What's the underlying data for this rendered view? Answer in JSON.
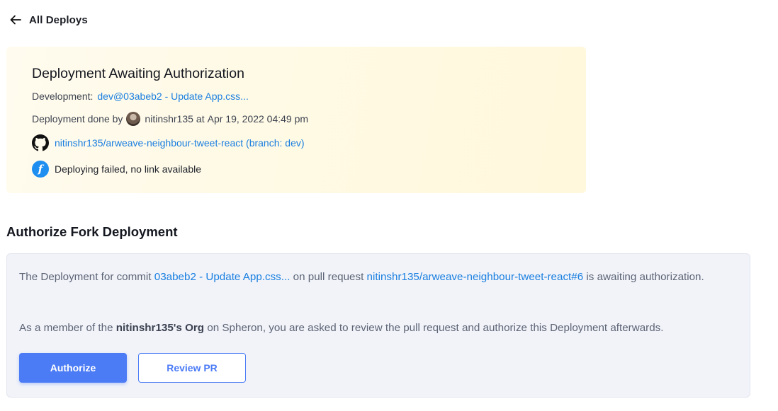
{
  "back": {
    "label": "All Deploys",
    "icon": "arrow-left-icon"
  },
  "deployment": {
    "title": "Deployment Awaiting Authorization",
    "env_label": "Development:",
    "env_link": "dev@03abeb2 - Update App.css...",
    "done_by_label": "Deployment done by",
    "done_by_user": "nitinshr135",
    "at_label": "at",
    "timestamp": "Apr 19, 2022 04:49 pm",
    "repo_link": "nitinshr135/arweave-neighbour-tweet-react (branch: dev)",
    "status_text": "Deploying failed, no link available"
  },
  "authorize": {
    "section_title": "Authorize Fork Deployment",
    "p1_pre": "The Deployment for commit",
    "p1_commit": "03abeb2 - Update App.css...",
    "p1_mid": "on pull request",
    "p1_pr": "nitinshr135/arweave-neighbour-tweet-react#6",
    "p1_post": "is awaiting authorization.",
    "p2_pre": "As a member of the",
    "p2_org": "nitinshr135's Org",
    "p2_post": "on Spheron, you are asked to review the pull request and authorize this Deployment afterwards.",
    "authorize_button": "Authorize",
    "review_button": "Review PR"
  },
  "colors": {
    "accent": "#4b7bf5",
    "link": "#1a7fe0",
    "card_bg": "#fffaea",
    "panel_bg": "#f1f3f9"
  }
}
